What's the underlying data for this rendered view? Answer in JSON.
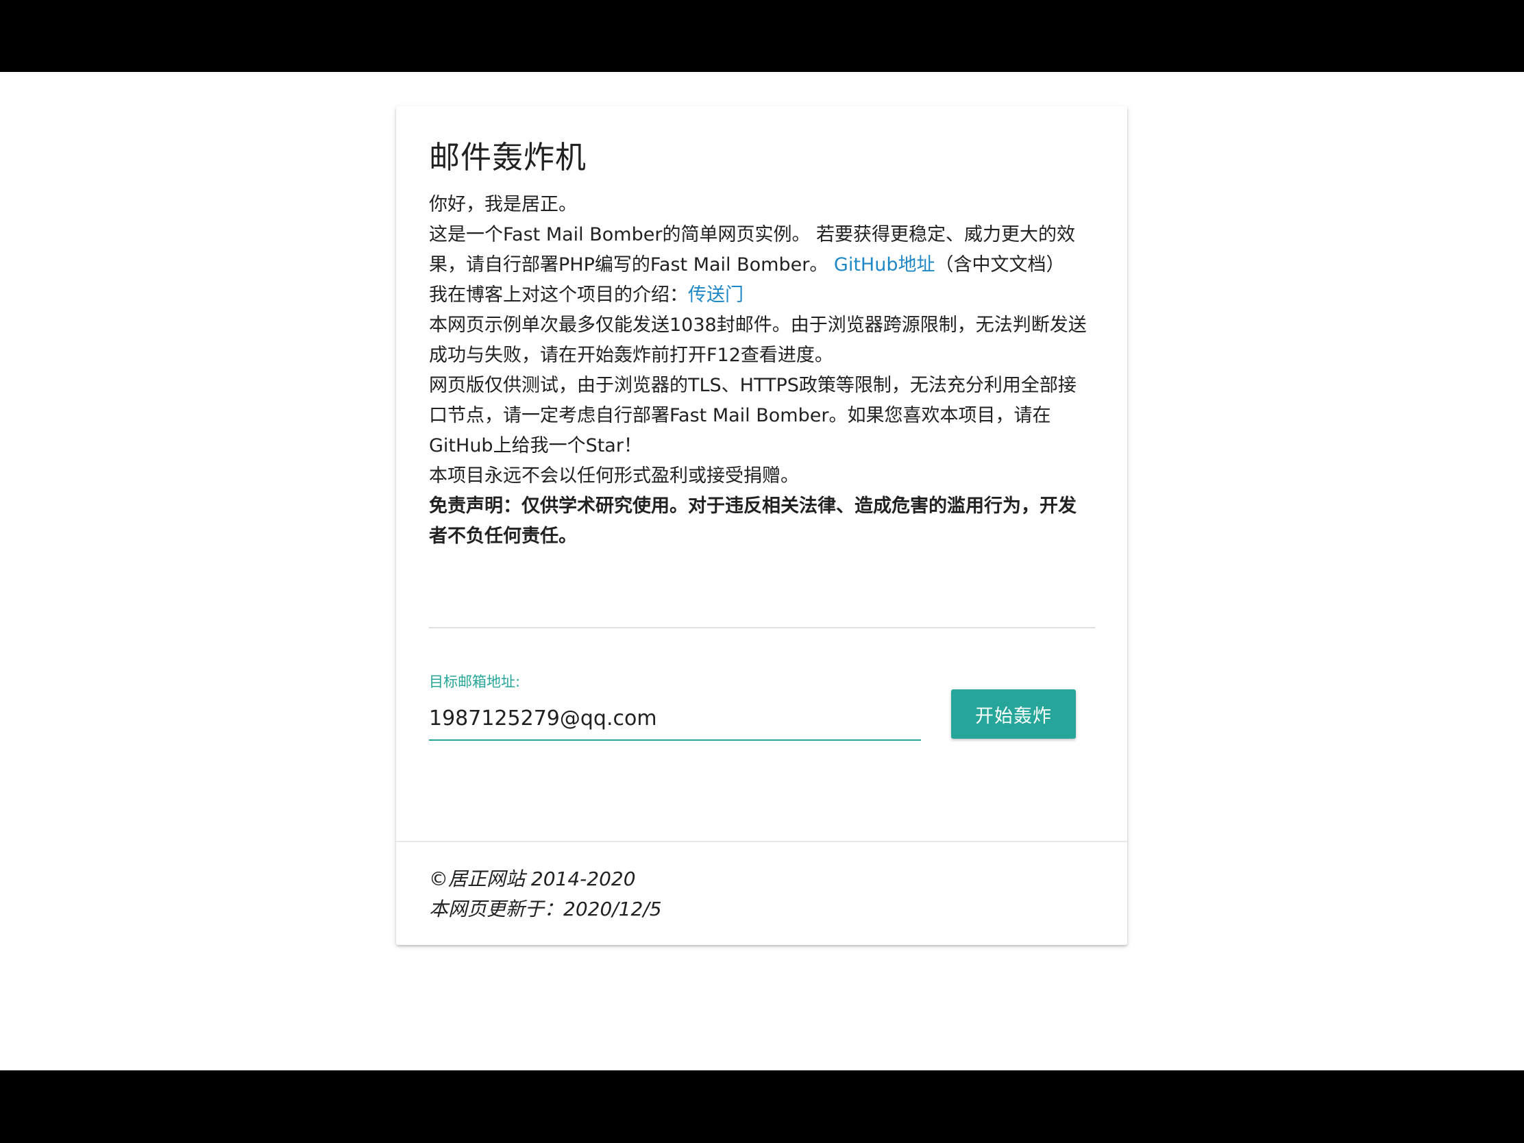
{
  "title": "邮件轰炸机",
  "intro": {
    "greeting": "你好，我是居正。",
    "desc_before_link": "这是一个Fast Mail Bomber的简单网页实例。 若要获得更稳定、威力更大的效果，请自行部署PHP编写的Fast Mail Bomber。",
    "github_link": "GitHub地址",
    "desc_after_link": "（含中文文档）",
    "blog_text": "我在博客上对这个项目的介绍：",
    "blog_link": "传送门",
    "limit_notice": "本网页示例单次最多仅能发送1038封邮件。由于浏览器跨源限制，无法判断发送成功与失败，请在开始轰炸前打开F12查看进度。",
    "test_notice": "网页版仅供测试，由于浏览器的TLS、HTTPS政策等限制，无法充分利用全部接口节点，请一定考虑自行部署Fast Mail Bomber。如果您喜欢本项目，请在GitHub上给我一个Star！",
    "no_profit": "本项目永远不会以任何形式盈利或接受捐赠。",
    "disclaimer": "免责声明：仅供学术研究使用。对于违反相关法律、造成危害的滥用行为，开发者不负任何责任。"
  },
  "form": {
    "label": "目标邮箱地址:",
    "email_value": "1987125279@qq.com",
    "button_label": "开始轰炸"
  },
  "footer": {
    "copyright": "©居正网站 2014-2020",
    "updated": "本网页更新于：2020/12/5"
  },
  "colors": {
    "accent": "#26a69a",
    "link": "#1e88c7",
    "text": "#212121"
  }
}
